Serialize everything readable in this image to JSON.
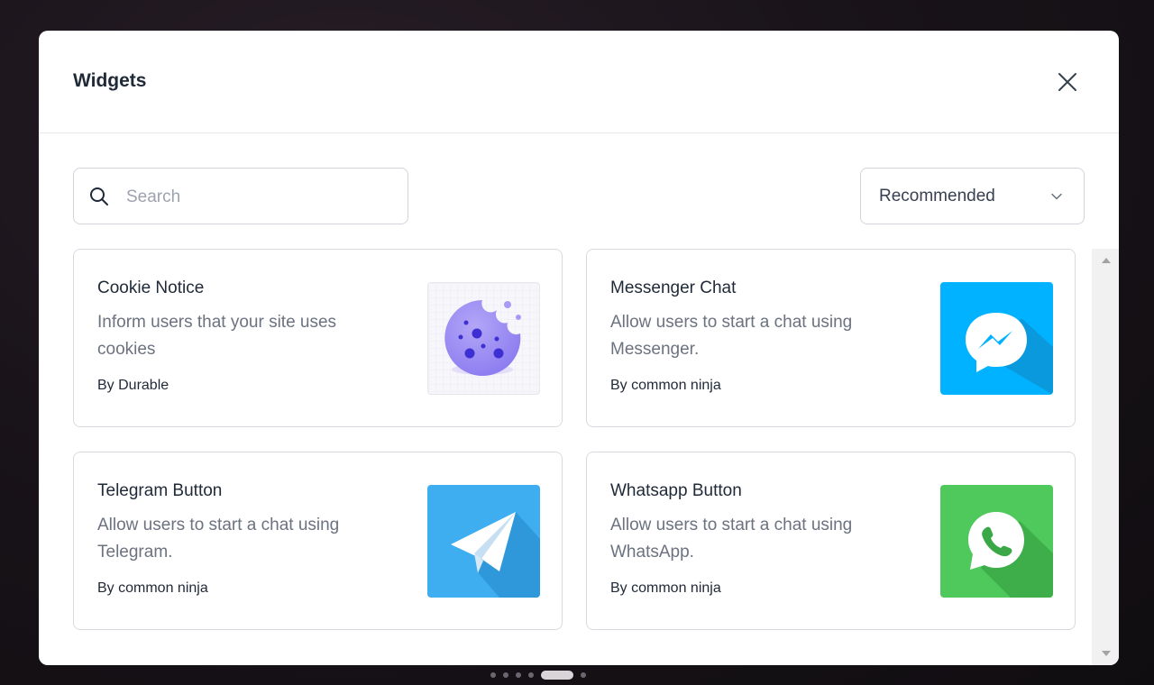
{
  "modal": {
    "title": "Widgets"
  },
  "search": {
    "placeholder": "Search",
    "value": ""
  },
  "sort": {
    "selected": "Recommended"
  },
  "widgets": [
    {
      "title": "Cookie Notice",
      "description": "Inform users that your site uses cookies",
      "author": "By Durable",
      "icon": "cookie-icon",
      "color": "#8b7cf0"
    },
    {
      "title": "Messenger Chat",
      "description": "Allow users to start a chat using Messenger.",
      "author": "By common ninja",
      "icon": "messenger-icon",
      "color": "#00b2ff"
    },
    {
      "title": "Telegram Button",
      "description": "Allow users to start a chat using Telegram.",
      "author": "By common ninja",
      "icon": "telegram-icon",
      "color": "#3eaef0"
    },
    {
      "title": "Whatsapp Button",
      "description": "Allow users to start a chat using WhatsApp.",
      "author": "By common ninja",
      "icon": "whatsapp-icon",
      "color": "#4fc95b"
    }
  ]
}
